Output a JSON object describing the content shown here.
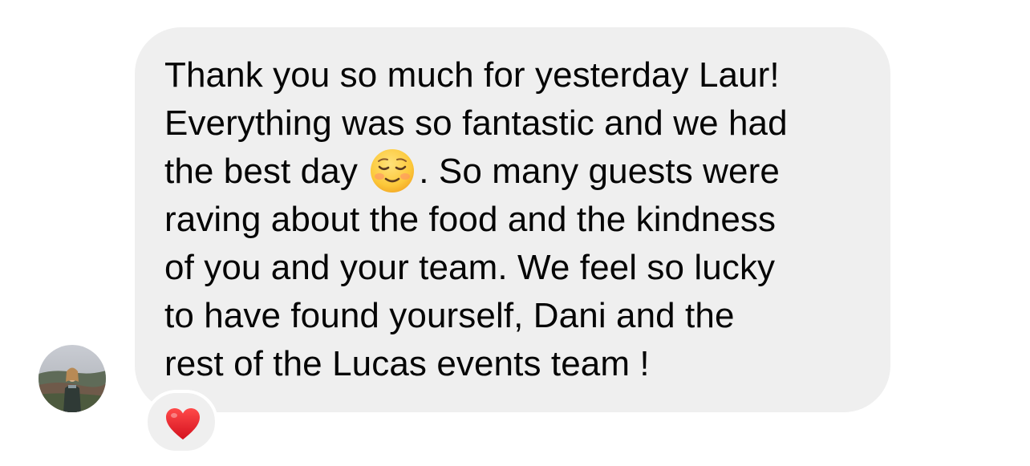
{
  "message": {
    "lines": [
      "Thank you so much for yesterday Laur!",
      "Everything was so fantastic and we had",
      "raving about the food and the kindness",
      "of you and your team. We feel so lucky",
      "to have found yourself, Dani and the",
      "rest of the Lucas events team !"
    ],
    "emoji_line": {
      "before": "the best day ",
      "emoji": "relieved-face-emoji",
      "after": ". So many guests were"
    }
  },
  "reaction": {
    "icon": "heart-icon",
    "color": "#e0202e"
  },
  "colors": {
    "bubble": "#efefef",
    "text": "#050505",
    "background": "#ffffff"
  }
}
